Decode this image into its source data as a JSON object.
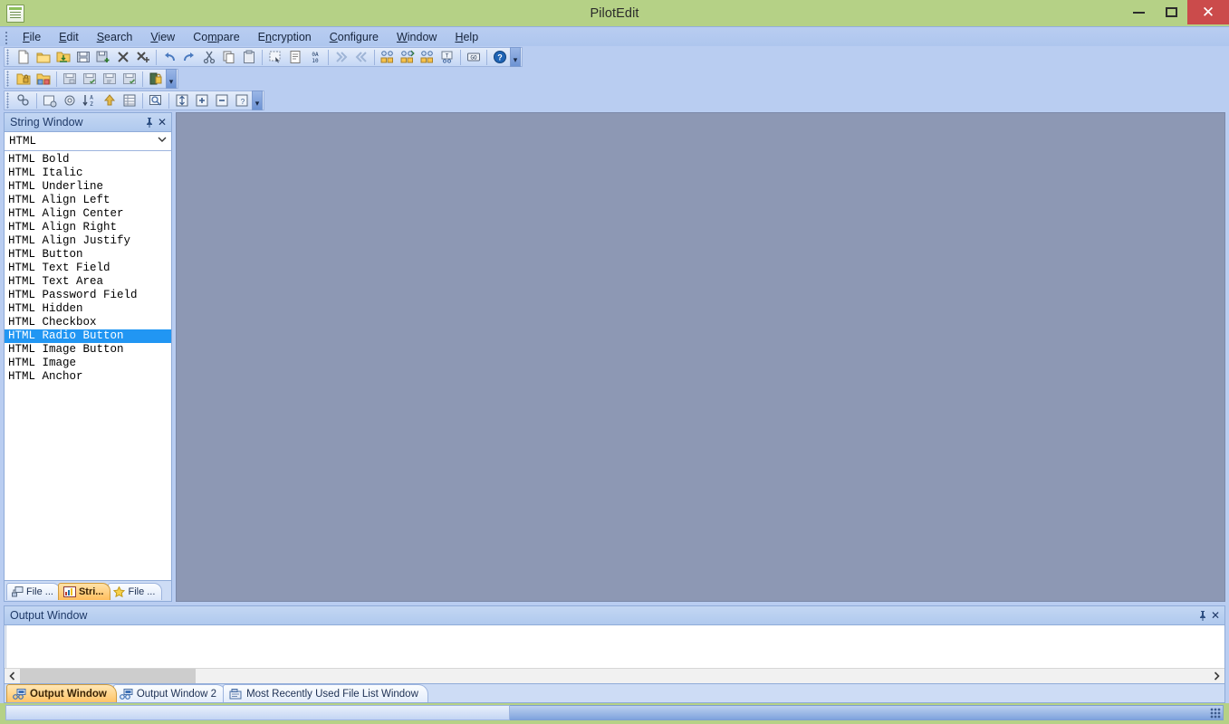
{
  "window": {
    "title": "PilotEdit",
    "icon": "document-lines-icon",
    "controls": {
      "minimize": "–",
      "maximize": "□",
      "close": "✕"
    }
  },
  "menubar": {
    "items": [
      {
        "label": "File",
        "accel": "F"
      },
      {
        "label": "Edit",
        "accel": "E"
      },
      {
        "label": "Search",
        "accel": "S"
      },
      {
        "label": "View",
        "accel": "V"
      },
      {
        "label": "Compare",
        "accel": "m"
      },
      {
        "label": "Encryption",
        "accel": "n"
      },
      {
        "label": "Configure",
        "accel": "C"
      },
      {
        "label": "Window",
        "accel": "W"
      },
      {
        "label": "Help",
        "accel": "H"
      }
    ]
  },
  "toolbars": {
    "row1": [
      {
        "name": "new-file-icon",
        "glyph": "὜B"
      },
      {
        "name": "open-folder-icon",
        "glyph": ""
      },
      {
        "name": "open-ftp-folder-icon",
        "glyph": ""
      },
      {
        "name": "save-icon",
        "glyph": ""
      },
      {
        "name": "save-as-icon",
        "glyph": ""
      },
      {
        "name": "close-file-icon",
        "glyph": "✕"
      },
      {
        "name": "close-all-files-icon",
        "glyph": "✕"
      },
      {
        "name": "undo-icon",
        "glyph": "↶"
      },
      {
        "name": "redo-icon",
        "glyph": "↷"
      },
      {
        "name": "cut-icon",
        "glyph": "✂"
      },
      {
        "name": "copy-icon",
        "glyph": ""
      },
      {
        "name": "paste-icon",
        "glyph": ""
      },
      {
        "name": "select-all-icon",
        "glyph": ""
      },
      {
        "name": "clipboard-icon",
        "glyph": ""
      },
      {
        "name": "hex-mode-icon",
        "glyph": "0A 10"
      },
      {
        "name": "next-icon",
        "glyph": "»"
      },
      {
        "name": "previous-icon",
        "glyph": "«"
      },
      {
        "name": "find-group-icon",
        "glyph": ""
      },
      {
        "name": "find-replace-group-icon",
        "glyph": ""
      },
      {
        "name": "find-files-group-icon",
        "glyph": ""
      },
      {
        "name": "sort-text-icon",
        "glyph": ""
      },
      {
        "name": "goto-line-icon",
        "glyph": "GO"
      },
      {
        "name": "help-icon",
        "glyph": "?"
      }
    ],
    "row2": [
      {
        "name": "ftp-open-icon",
        "glyph": ""
      },
      {
        "name": "ftp-upload-icon",
        "glyph": ""
      },
      {
        "name": "encrypt-file-icon",
        "glyph": ""
      },
      {
        "name": "decrypt-file-icon",
        "glyph": ""
      },
      {
        "name": "encrypt-folder-icon",
        "glyph": ""
      },
      {
        "name": "decrypt-folder-icon",
        "glyph": ""
      },
      {
        "name": "lock-icon",
        "glyph": ""
      }
    ],
    "row3": [
      {
        "name": "compare-files-icon",
        "glyph": ""
      },
      {
        "name": "file-settings-icon",
        "glyph": ""
      },
      {
        "name": "options-gear-icon",
        "glyph": ""
      },
      {
        "name": "sort-az-icon",
        "glyph": "AZ"
      },
      {
        "name": "move-up-icon",
        "glyph": "⇧"
      },
      {
        "name": "grid-view-icon",
        "glyph": ""
      },
      {
        "name": "preview-icon",
        "glyph": ""
      },
      {
        "name": "expand-all-icon",
        "glyph": "↕"
      },
      {
        "name": "zoom-in-icon",
        "glyph": "+"
      },
      {
        "name": "zoom-out-icon",
        "glyph": "−"
      },
      {
        "name": "help-context-icon",
        "glyph": "?"
      }
    ],
    "overflow_label": "▾"
  },
  "string_window": {
    "title": "String Window",
    "pin_icon": "\u0001",
    "close_icon": "✕",
    "combo": {
      "value": "HTML",
      "arrow": "⌄"
    },
    "items": [
      "HTML Bold",
      "HTML Italic",
      "HTML Underline",
      "HTML Align Left",
      "HTML Align Center",
      "HTML Align Right",
      "HTML Align Justify",
      "HTML Button",
      "HTML Text Field",
      "HTML Text Area",
      "HTML Password Field",
      "HTML Hidden",
      "HTML Checkbox",
      "HTML Radio Button",
      "HTML Image Button",
      "HTML Image",
      "HTML Anchor"
    ],
    "selected_index": 13,
    "tabs": [
      {
        "label": "File ...",
        "icon": "file-tree-icon",
        "active": false
      },
      {
        "label": "Stri...",
        "icon": "string-window-icon",
        "active": true
      },
      {
        "label": "File ...",
        "icon": "favorites-star-icon",
        "active": false
      }
    ]
  },
  "output_window": {
    "title": "Output Window",
    "pin_icon": "\u0001",
    "close_icon": "✕",
    "content": "",
    "scrollbar": {
      "left_arrow": "‹",
      "right_arrow": "›"
    },
    "tabs": [
      {
        "label": "Output Window",
        "icon": "output-window-icon",
        "active": true
      },
      {
        "label": "Output Window 2",
        "icon": "output-window-icon",
        "active": false
      },
      {
        "label": "Most Recently Used File List Window",
        "icon": "mru-list-icon",
        "active": false
      }
    ]
  },
  "statusbar": {
    "left_text": "",
    "right_text": "",
    "resize_grip": "resize-grip-icon"
  },
  "colors": {
    "window_frame": "#b5d186",
    "menu_bar": "#b9cdf1",
    "editor_background": "#8d98b4",
    "selection": "#2196f3",
    "active_tab": "#ffc468",
    "close_button": "#cb4b4b"
  }
}
